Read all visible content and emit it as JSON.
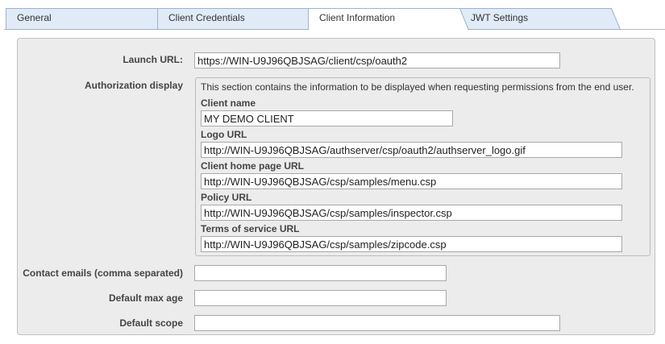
{
  "tabs": [
    {
      "label": "General",
      "active": false
    },
    {
      "label": "Client Credentials",
      "active": false
    },
    {
      "label": "Client Information",
      "active": true
    },
    {
      "label": "JWT Settings",
      "active": false
    }
  ],
  "colors": {
    "tab_inactive": "#e1ebf7",
    "tab_active": "#ffffff",
    "panel_bg": "#ececec",
    "border": "#c0c0c0"
  },
  "form": {
    "launch_url": {
      "label": "Launch URL:",
      "value": "https://WIN-U9J96QBJSAG/client/csp/oauth2"
    },
    "authorization_display": {
      "label": "Authorization display",
      "description": "This section contains the information to be displayed when requesting permissions from the end user.",
      "client_name": {
        "label": "Client name",
        "value": "MY DEMO CLIENT"
      },
      "logo_url": {
        "label": "Logo URL",
        "value": "http://WIN-U9J96QBJSAG/authserver/csp/oauth2/authserver_logo.gif"
      },
      "client_home_page_url": {
        "label": "Client home page URL",
        "value": "http://WIN-U9J96QBJSAG/csp/samples/menu.csp"
      },
      "policy_url": {
        "label": "Policy URL",
        "value": "http://WIN-U9J96QBJSAG/csp/samples/inspector.csp"
      },
      "terms_of_service_url": {
        "label": "Terms of service URL",
        "value": "http://WIN-U9J96QBJSAG/csp/samples/zipcode.csp"
      }
    },
    "contact_emails": {
      "label": "Contact emails (comma separated)",
      "value": ""
    },
    "default_max_age": {
      "label": "Default max age",
      "value": ""
    },
    "default_scope": {
      "label": "Default scope",
      "value": ""
    }
  }
}
